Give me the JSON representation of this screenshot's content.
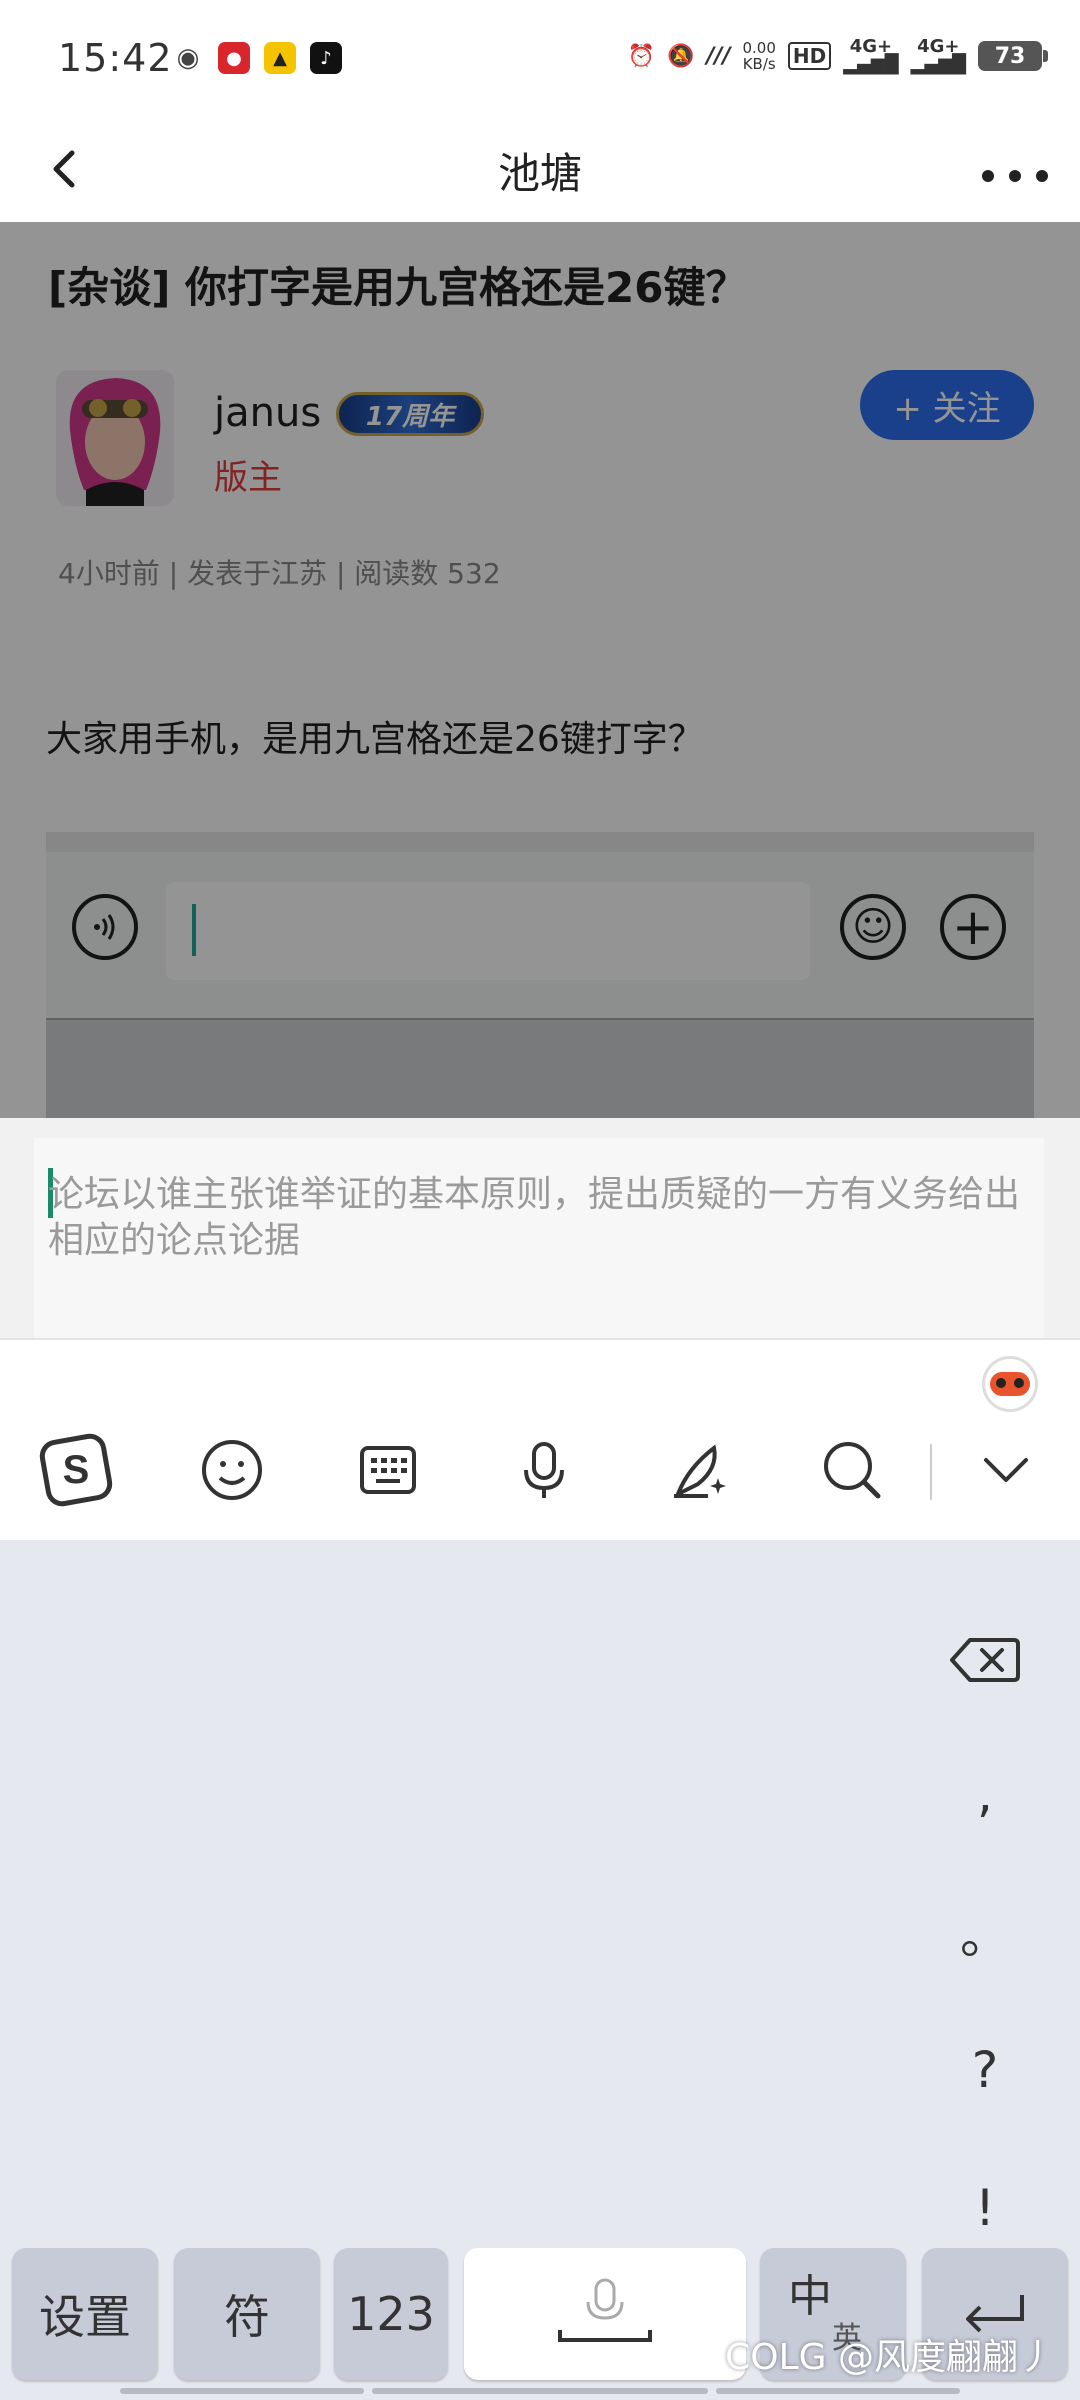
{
  "status_bar": {
    "time": "15:42",
    "net_speed_value": "0.00",
    "net_speed_unit": "KB/s",
    "hd": "HD",
    "signal1": "4G+",
    "signal2": "4G+",
    "battery": "73"
  },
  "nav": {
    "title": "池塘"
  },
  "post": {
    "title": "[杂谈] 你打字是用九宫格还是26键？",
    "author": {
      "name": "janus",
      "badge": "17周年",
      "role": "版主"
    },
    "follow_label": "+ 关注",
    "meta": "4小时前 | 发表于江苏 | 阅读数 532",
    "body": "大家用手机，是用九宫格还是26键打字？"
  },
  "reply": {
    "placeholder": "论坛以谁主张谁举证的基本原则，提出质疑的一方有义务给出相应的论点论据"
  },
  "keyboard": {
    "side_keys": [
      ",",
      "。",
      "?",
      "!"
    ],
    "settings_label": "设置",
    "symbols_label": "符",
    "numbers_label": "123",
    "lang_label": "中",
    "lang_sub": "英",
    "enter_symbol": "↵"
  },
  "watermark": "COLG @风度翩翩丿",
  "colors": {
    "accent": "#2f6ff0",
    "role_red": "#e03b3b",
    "keyboard_bg": "#e6e8ef"
  }
}
